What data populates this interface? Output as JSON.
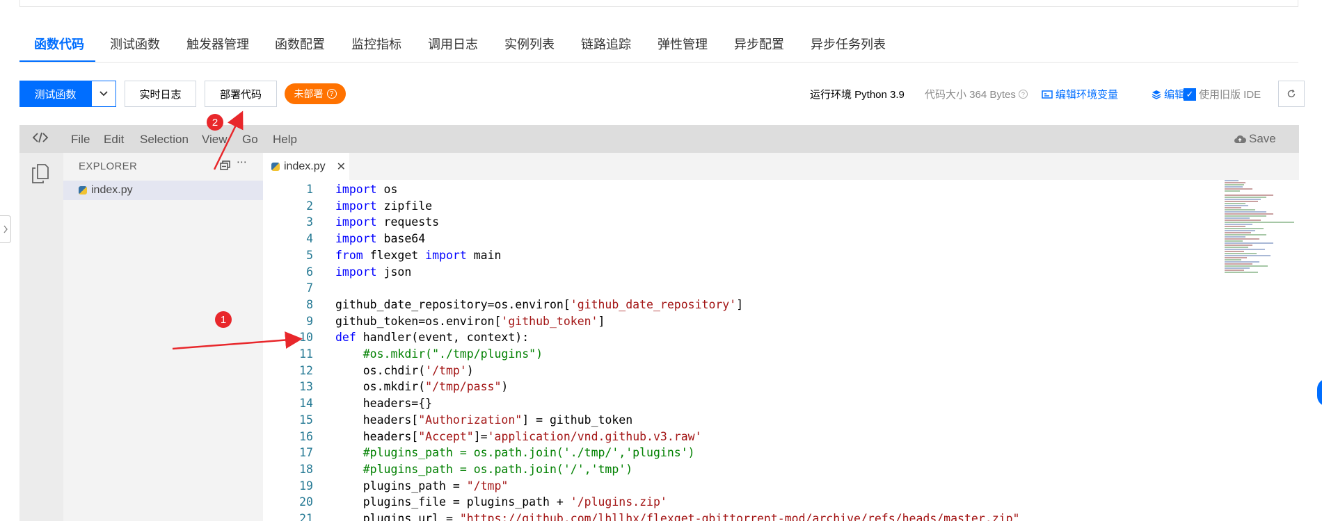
{
  "tabs": [
    "函数代码",
    "测试函数",
    "触发器管理",
    "函数配置",
    "监控指标",
    "调用日志",
    "实例列表",
    "链路追踪",
    "弹性管理",
    "异步配置",
    "异步任务列表"
  ],
  "toolbar": {
    "test_fn": "测试函数",
    "realtime_log": "实时日志",
    "deploy": "部署代码",
    "status": "未部署",
    "runtime": "运行环境 Python 3.9",
    "code_size": "代码大小 364 Bytes",
    "edit_env": "编辑环境变量",
    "edit_layer": "编辑层",
    "legacy_ide": "使用旧版 IDE"
  },
  "ide": {
    "menu": [
      "File",
      "Edit",
      "Selection",
      "View",
      "Go",
      "Help"
    ],
    "save": "Save",
    "explorer_title": "EXPLORER",
    "file_name": "index.py",
    "tab_name": "index.py"
  },
  "code": [
    {
      "n": "1",
      "s": [
        [
          "k",
          "import"
        ],
        [
          "t",
          " os"
        ]
      ]
    },
    {
      "n": "2",
      "s": [
        [
          "k",
          "import"
        ],
        [
          "t",
          " zipfile"
        ]
      ]
    },
    {
      "n": "3",
      "s": [
        [
          "k",
          "import"
        ],
        [
          "t",
          " requests"
        ]
      ]
    },
    {
      "n": "4",
      "s": [
        [
          "k",
          "import"
        ],
        [
          "t",
          " base64"
        ]
      ]
    },
    {
      "n": "5",
      "s": [
        [
          "k",
          "from"
        ],
        [
          "t",
          " flexget "
        ],
        [
          "k",
          "import"
        ],
        [
          "t",
          " main"
        ]
      ]
    },
    {
      "n": "6",
      "s": [
        [
          "k",
          "import"
        ],
        [
          "t",
          " json"
        ]
      ]
    },
    {
      "n": "7",
      "s": []
    },
    {
      "n": "8",
      "s": [
        [
          "t",
          "github_date_repository=os.environ["
        ],
        [
          "s",
          "'github_date_repository'"
        ],
        [
          "t",
          "]"
        ]
      ]
    },
    {
      "n": "9",
      "s": [
        [
          "t",
          "github_token=os.environ["
        ],
        [
          "s",
          "'github_token'"
        ],
        [
          "t",
          "]"
        ]
      ]
    },
    {
      "n": "10",
      "s": [
        [
          "k",
          "def"
        ],
        [
          "t",
          " handler(event, context):"
        ]
      ]
    },
    {
      "n": "11",
      "s": [
        [
          "t",
          "    "
        ],
        [
          "c",
          "#os.mkdir(\"./tmp/plugins\")"
        ]
      ]
    },
    {
      "n": "12",
      "s": [
        [
          "t",
          "    os.chdir("
        ],
        [
          "s",
          "'/tmp'"
        ],
        [
          "t",
          ")"
        ]
      ]
    },
    {
      "n": "13",
      "s": [
        [
          "t",
          "    os.mkdir("
        ],
        [
          "s",
          "\"/tmp/pass\""
        ],
        [
          "t",
          ")"
        ]
      ]
    },
    {
      "n": "14",
      "s": [
        [
          "t",
          "    headers={}"
        ]
      ]
    },
    {
      "n": "15",
      "s": [
        [
          "t",
          "    headers["
        ],
        [
          "s",
          "\"Authorization\""
        ],
        [
          "t",
          "] = github_token"
        ]
      ]
    },
    {
      "n": "16",
      "s": [
        [
          "t",
          "    headers["
        ],
        [
          "s",
          "\"Accept\""
        ],
        [
          "t",
          "]="
        ],
        [
          "s",
          "'application/vnd.github.v3.raw'"
        ]
      ]
    },
    {
      "n": "17",
      "s": [
        [
          "t",
          "    "
        ],
        [
          "c",
          "#plugins_path = os.path.join('./tmp/','plugins')"
        ]
      ]
    },
    {
      "n": "18",
      "s": [
        [
          "t",
          "    "
        ],
        [
          "c",
          "#plugins_path = os.path.join('/','tmp')"
        ]
      ]
    },
    {
      "n": "19",
      "s": [
        [
          "t",
          "    plugins_path = "
        ],
        [
          "s",
          "\"/tmp\""
        ]
      ]
    },
    {
      "n": "20",
      "s": [
        [
          "t",
          "    plugins_file = plugins_path + "
        ],
        [
          "s",
          "'/plugins.zip'"
        ]
      ]
    },
    {
      "n": "21",
      "s": [
        [
          "t",
          "    plugins_url = "
        ],
        [
          "s",
          "\"https://github.com/lhllhx/flexget-qbittorrent-mod/archive/refs/heads/master.zip\""
        ]
      ]
    }
  ],
  "annotations": {
    "badge1": "1",
    "badge2": "2"
  },
  "colors": {
    "accent": "#006eff",
    "keyword": "#0000ff",
    "string": "#a31515",
    "comment": "#008000",
    "status": "#ff7200",
    "annotation": "#e8272b"
  }
}
